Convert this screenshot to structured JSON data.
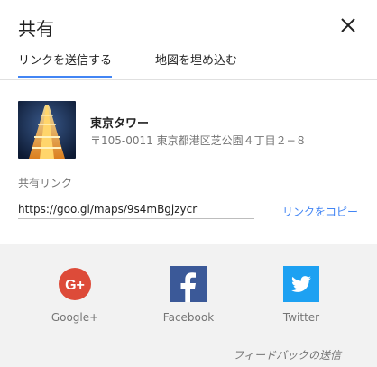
{
  "dialog": {
    "title": "共有",
    "close_icon": "close-icon"
  },
  "tabs": [
    {
      "label": "リンクを送信する",
      "active": true
    },
    {
      "label": "地図を埋め込む",
      "active": false
    }
  ],
  "place": {
    "name": "東京タワー",
    "address": "〒105-0011 東京都港区芝公園４丁目２−８",
    "thumbnail_icon": "tokyo-tower-photo"
  },
  "share_link": {
    "label": "共有リンク",
    "url": "https://goo.gl/maps/9s4mBgjzycr",
    "copy_label": "リンクをコピー"
  },
  "social": [
    {
      "label": "Google+",
      "icon": "google-plus-icon",
      "color": "#dd4b39"
    },
    {
      "label": "Facebook",
      "icon": "facebook-icon",
      "color": "#3b5998"
    },
    {
      "label": "Twitter",
      "icon": "twitter-icon",
      "color": "#1da1f2"
    }
  ],
  "feedback_label": "フィードバックの送信",
  "colors": {
    "accent": "#4285f4",
    "panel_bg": "#f2f2f2"
  }
}
